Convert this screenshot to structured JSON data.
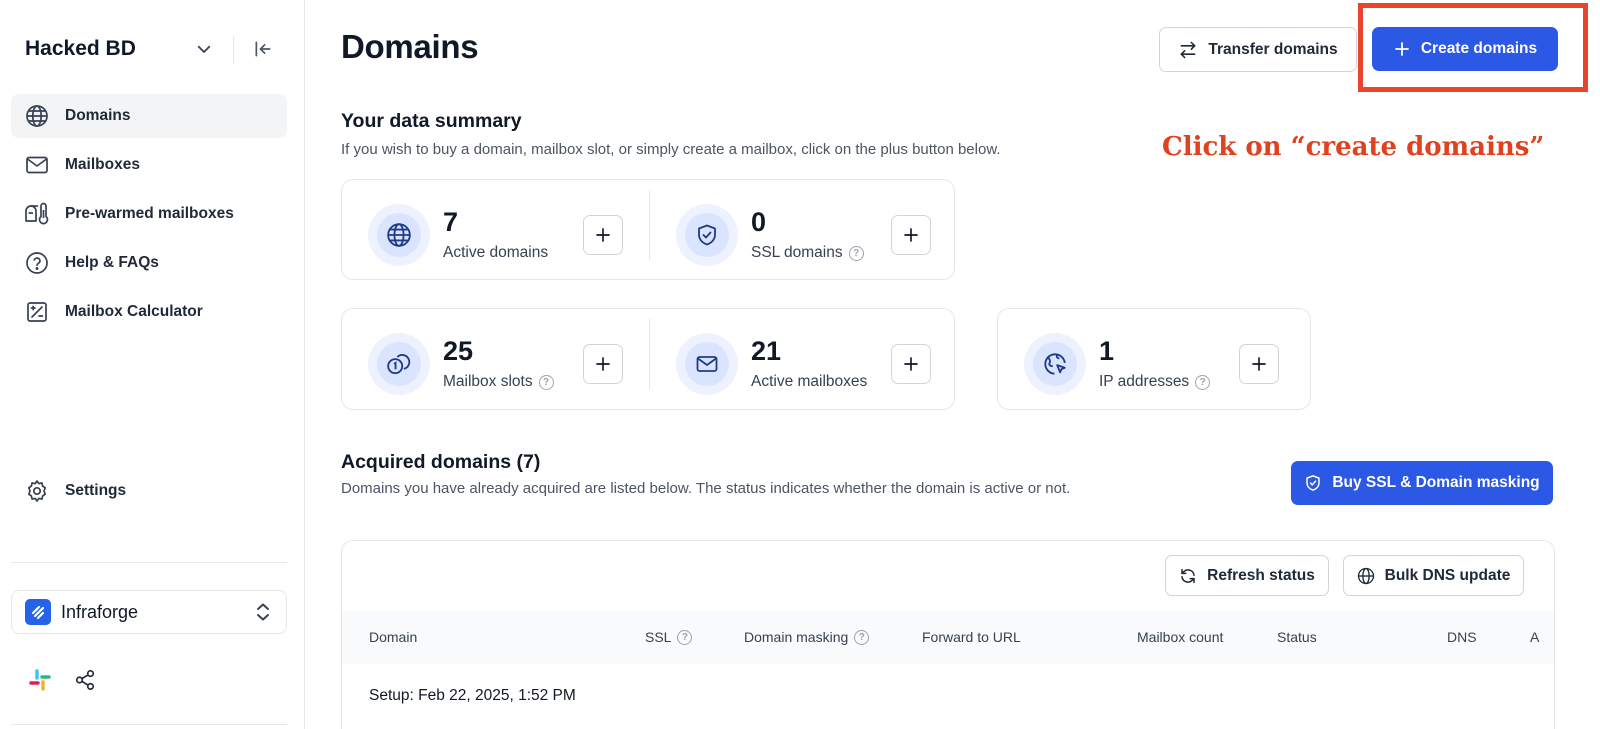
{
  "sidebar": {
    "workspace_name": "Hacked BD",
    "nav": [
      {
        "label": "Domains",
        "icon": "globe-icon",
        "active": true
      },
      {
        "label": "Mailboxes",
        "icon": "mail-icon"
      },
      {
        "label": "Pre-warmed mailboxes",
        "icon": "mailbox-thermometer-icon"
      },
      {
        "label": "Help & FAQs",
        "icon": "help-circle-icon"
      },
      {
        "label": "Mailbox Calculator",
        "icon": "calculator-icon"
      }
    ],
    "settings_label": "Settings",
    "org_name": "Infraforge"
  },
  "header": {
    "title": "Domains",
    "transfer_label": "Transfer domains",
    "create_label": "Create domains"
  },
  "annotation": "Click on “create domains”",
  "summary": {
    "title": "Your data summary",
    "subtitle": "If you wish to buy a domain, mailbox slot, or simply create a mailbox, click on the plus button below.",
    "stats": [
      {
        "value": "7",
        "label": "Active domains",
        "icon": "globe-icon"
      },
      {
        "value": "0",
        "label": "SSL domains",
        "icon": "shield-check-icon"
      },
      {
        "value": "25",
        "label": "Mailbox slots",
        "icon": "mailbox-slot-icon"
      },
      {
        "value": "21",
        "label": "Active mailboxes",
        "icon": "mail-icon"
      },
      {
        "value": "1",
        "label": "IP addresses",
        "icon": "ip-globe-cursor-icon"
      }
    ]
  },
  "acquired": {
    "title": "Acquired domains (7)",
    "subtitle": "Domains you have already acquired are listed below. The status indicates whether the domain is active or not.",
    "buy_ssl_label": "Buy SSL & Domain masking",
    "refresh_label": "Refresh status",
    "bulk_dns_label": "Bulk DNS update",
    "columns": [
      "Domain",
      "SSL",
      "Domain masking",
      "Forward to URL",
      "Mailbox count",
      "Status",
      "DNS",
      "A"
    ],
    "setup_row": "Setup: Feb 22, 2025, 1:52 PM"
  },
  "colors": {
    "primary": "#2b58e4",
    "annotation": "#e0421f",
    "icon_blue": "#1e3a8a"
  }
}
